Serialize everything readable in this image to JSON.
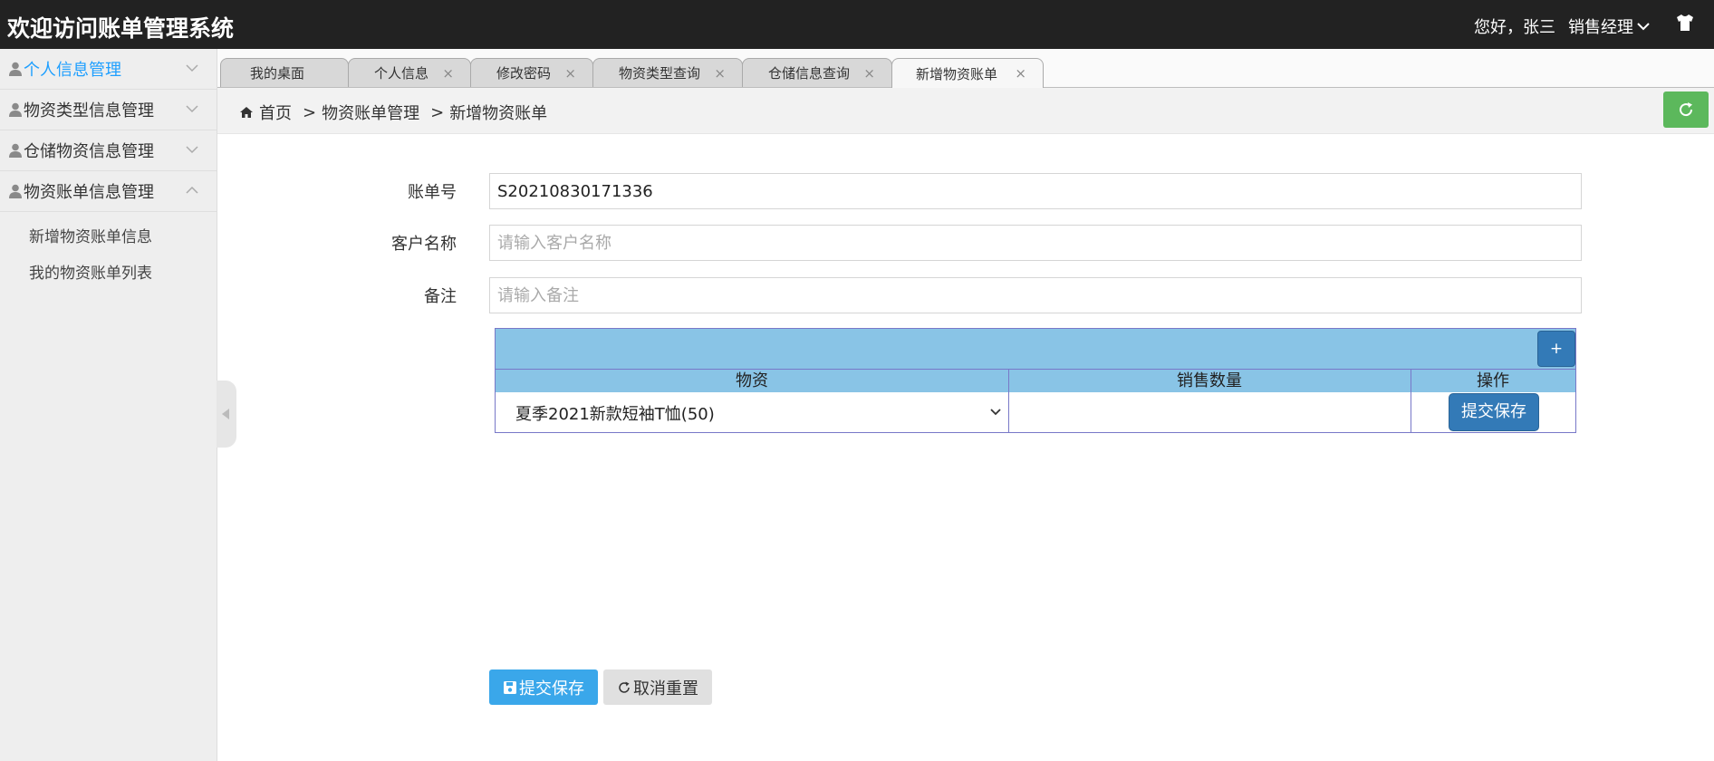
{
  "header": {
    "title": "欢迎访问账单管理系统",
    "greeting": "您好，张三",
    "role": "销售经理",
    "shirt_icon": "shirt-icon"
  },
  "sidebar": {
    "items": [
      {
        "label": "个人信息管理",
        "active": true
      },
      {
        "label": "物资类型信息管理",
        "active": false
      },
      {
        "label": "仓储物资信息管理",
        "active": false
      },
      {
        "label": "物资账单信息管理",
        "active": false,
        "expanded": true
      }
    ],
    "sub_items": [
      "新增物资账单信息",
      "我的物资账单列表"
    ]
  },
  "tabs": [
    {
      "label": "我的桌面",
      "closable": false
    },
    {
      "label": "个人信息",
      "closable": true
    },
    {
      "label": "修改密码",
      "closable": true
    },
    {
      "label": "物资类型查询",
      "closable": true
    },
    {
      "label": "仓储信息查询",
      "closable": true
    },
    {
      "label": "新增物资账单",
      "closable": true,
      "active": true
    }
  ],
  "tab_close_glyph": "×",
  "breadcrumb": {
    "home": "首页",
    "separator": ">",
    "level1": "物资账单管理",
    "level2": "新增物资账单"
  },
  "form": {
    "bill_no": {
      "label": "账单号",
      "value": "S20210830171336"
    },
    "customer": {
      "label": "客户名称",
      "placeholder": "请输入客户名称"
    },
    "remark": {
      "label": "备注",
      "placeholder": "请输入备注"
    }
  },
  "detail_table": {
    "add_label": "+",
    "headers": [
      "物资",
      "销售数量",
      "操作"
    ],
    "row": {
      "material": "夏季2021新款短袖T恤(50)",
      "quantity": "",
      "action_label": "提交保存"
    }
  },
  "buttons": {
    "save": "提交保存",
    "reset": "取消重置"
  },
  "colors": {
    "header_bg": "#222222",
    "accent_blue": "#1e9fff",
    "table_header": "#89c4e6",
    "primary": "#337ab7",
    "save_button": "#3aa7ea",
    "refresh_green": "#5cb85c"
  }
}
